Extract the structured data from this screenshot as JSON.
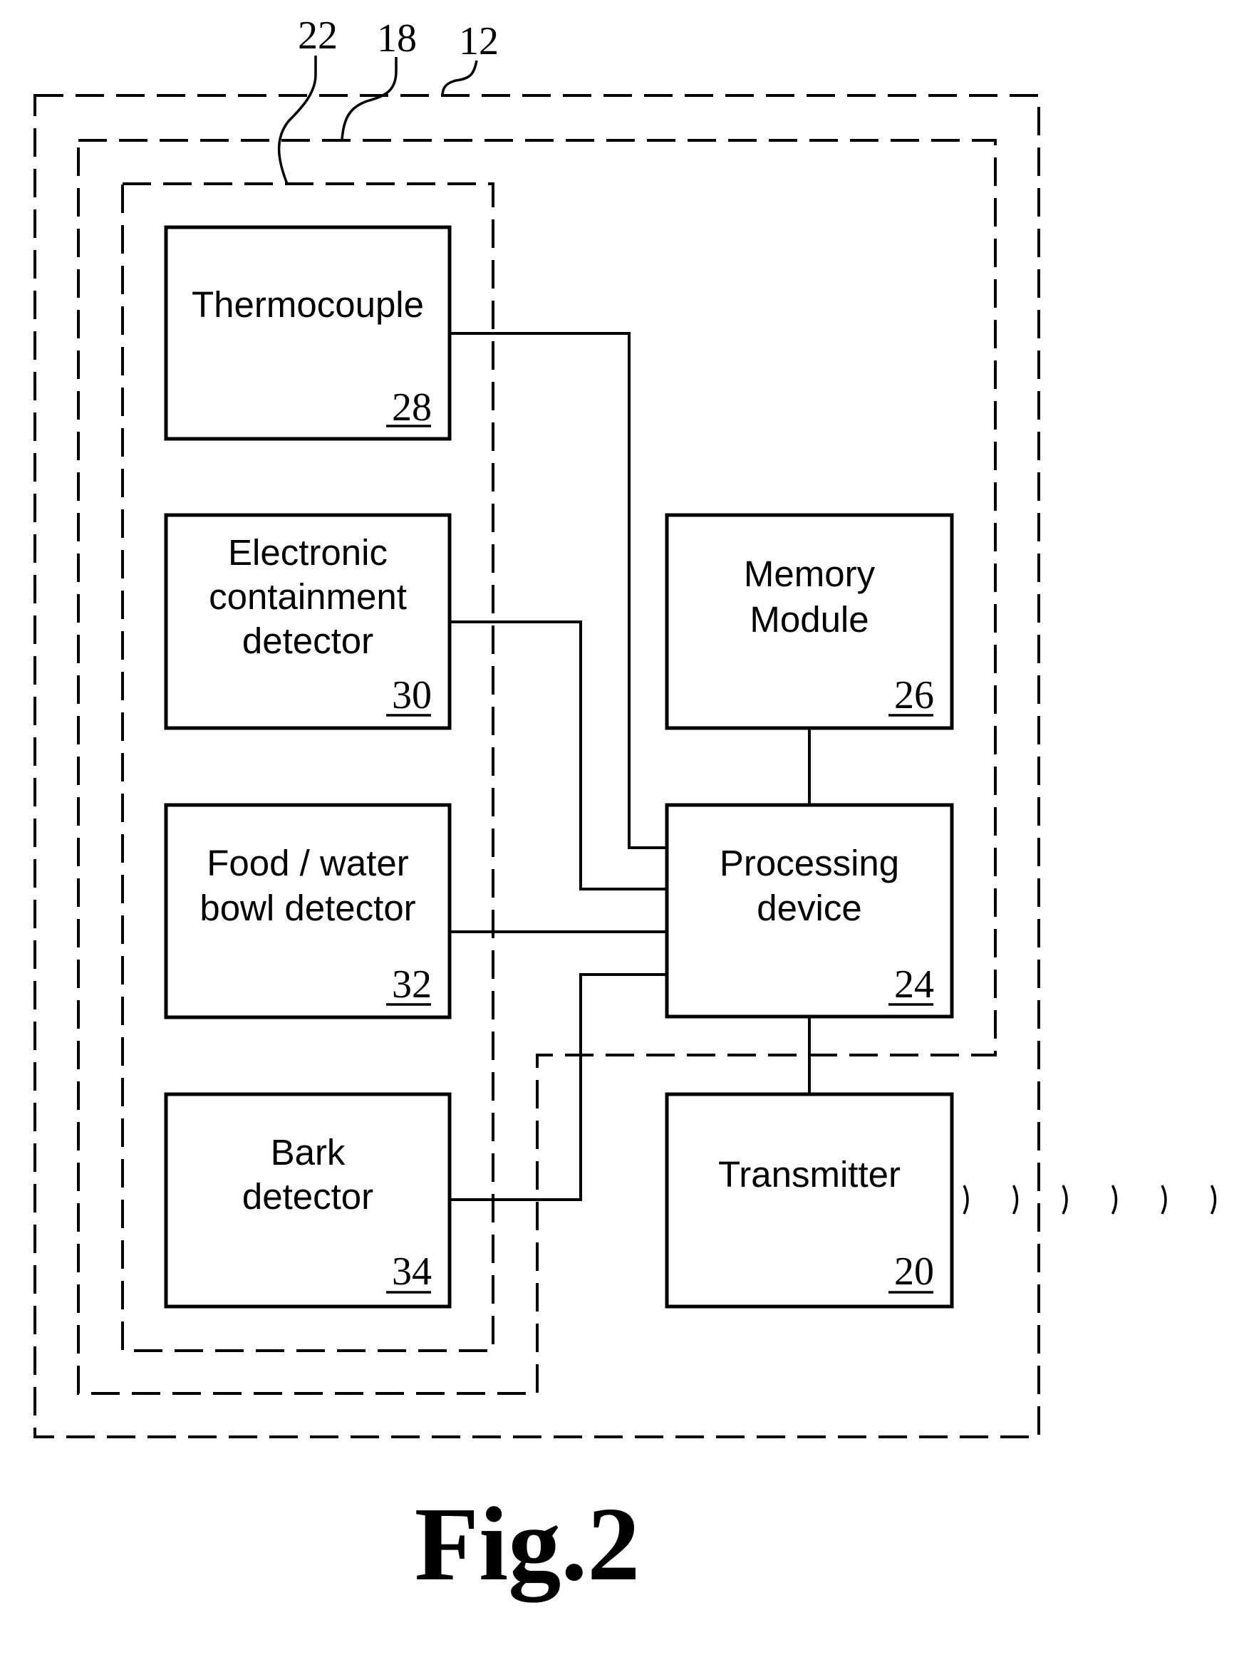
{
  "figure": {
    "caption": "Fig.2",
    "callouts": {
      "outer_housing": "12",
      "middle_enclosure": "18",
      "sensor_group": "22"
    },
    "blocks": {
      "thermocouple": {
        "lines": [
          "Thermocouple"
        ],
        "ref": "28"
      },
      "containment": {
        "lines": [
          "Electronic",
          "containment",
          "detector"
        ],
        "ref": "30"
      },
      "food_water": {
        "lines": [
          "Food / water",
          "bowl detector"
        ],
        "ref": "32"
      },
      "bark": {
        "lines": [
          "Bark",
          "detector"
        ],
        "ref": "34"
      },
      "memory": {
        "lines": [
          "Memory",
          "Module"
        ],
        "ref": "26"
      },
      "processing": {
        "lines": [
          "Processing",
          "device"
        ],
        "ref": "24"
      },
      "transmitter": {
        "lines": [
          "Transmitter"
        ],
        "ref": "20"
      }
    },
    "signal_waves": {
      "count": 6,
      "glyph": ")"
    }
  }
}
